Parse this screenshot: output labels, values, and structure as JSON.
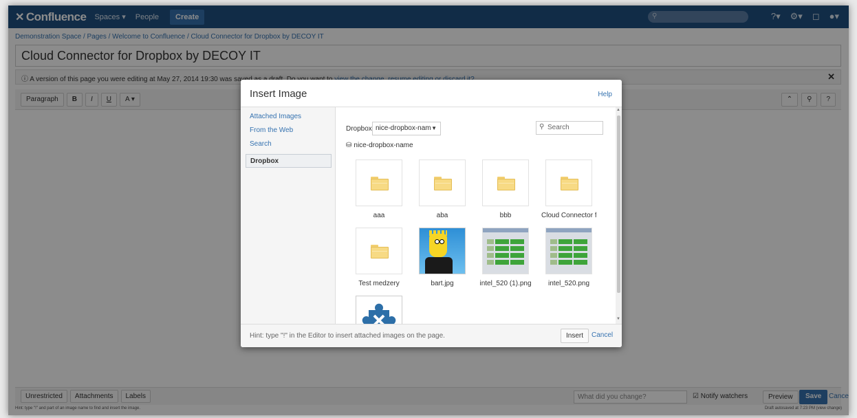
{
  "topnav": {
    "logo": "Confluence",
    "spaces": "Spaces ▾",
    "people": "People",
    "create": "Create"
  },
  "page": {
    "breadcrumb": "Demonstration Space / Pages / Welcome to Confluence / Cloud Connector for Dropbox by DECOY IT",
    "title": "Cloud Connector for Dropbox by DECOY IT",
    "draft_notice": "A version of this page you were editing at May 27, 2014 19:30 was saved as a draft. Do you want to",
    "draft_link": "view the change, resume editing or discard it?",
    "paragraph_select": "Paragraph"
  },
  "footer": {
    "unrestricted": "Unrestricted",
    "attachments": "Attachments",
    "labels": "Labels",
    "change_placeholder": "What did you change?",
    "notify": "Notify watchers",
    "preview": "Preview",
    "save": "Save",
    "cancel": "Cancel",
    "hint": "Hint: type \"!\" and part of an image name to find and insert the image.",
    "autosave": "Draft autosaved at 7:23 PM (view change)"
  },
  "dialog": {
    "title": "Insert Image",
    "help": "Help",
    "sidebar": [
      "Attached Images",
      "From the Web",
      "Search",
      "Dropbox"
    ],
    "dropbox_label": "Dropbox:",
    "dropbox_select": "nice-dropbox-nam",
    "search_placeholder": "Search",
    "path": "nice-dropbox-name",
    "items": [
      {
        "name": "aaa",
        "kind": "folder"
      },
      {
        "name": "aba",
        "kind": "folder"
      },
      {
        "name": "bbb",
        "kind": "folder"
      },
      {
        "name": "Cloud Connector fc",
        "kind": "folder"
      },
      {
        "name": "Test medzery",
        "kind": "folder"
      },
      {
        "name": "bart.jpg",
        "kind": "image"
      },
      {
        "name": "intel_520 (1).png",
        "kind": "image"
      },
      {
        "name": "intel_520.png",
        "kind": "image"
      }
    ],
    "hint": "Hint: type \"!\" in the Editor to insert attached images on the page.",
    "insert": "Insert",
    "cancel": "Cancel"
  },
  "colors": {
    "nav_bg": "#205081",
    "primary": "#3572b0"
  }
}
